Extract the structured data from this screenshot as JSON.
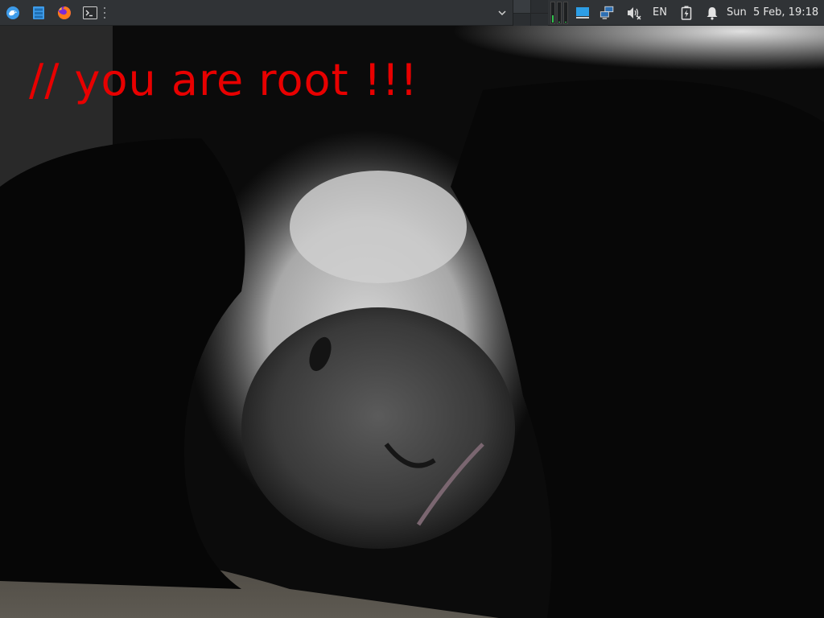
{
  "panel": {
    "launchers": [
      {
        "icon": "app-menu-icon",
        "color": "#4aa8e8"
      },
      {
        "icon": "file-manager-icon",
        "color": "#3d9be9"
      },
      {
        "icon": "firefox-icon",
        "color": "#ff7a18"
      },
      {
        "icon": "terminal-icon",
        "color": "#d0d0d0"
      }
    ],
    "language": "EN",
    "clock": "Sun  5 Feb, 19:18",
    "cpu_usage": [
      0.35,
      0.05,
      0.05
    ]
  },
  "desktop": {
    "wallpaper_caption": "// you are root !!!",
    "caption_color": "#e80000"
  }
}
